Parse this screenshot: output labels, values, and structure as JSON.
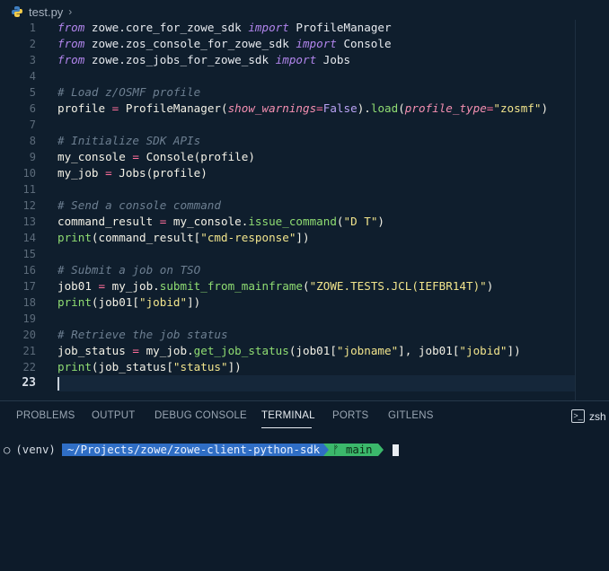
{
  "editor": {
    "breadcrumb": {
      "file_name": "test.py",
      "separator": "›"
    },
    "active_line": 23,
    "lines": [
      {
        "n": "1",
        "tokens": [
          [
            "kw",
            "from"
          ],
          [
            "mod",
            " zowe.core_for_zowe_sdk "
          ],
          [
            "kw",
            "import"
          ],
          [
            "mod",
            " ProfileManager"
          ]
        ]
      },
      {
        "n": "2",
        "tokens": [
          [
            "kw",
            "from"
          ],
          [
            "mod",
            " zowe.zos_console_for_zowe_sdk "
          ],
          [
            "kw",
            "import"
          ],
          [
            "mod",
            " Console"
          ]
        ]
      },
      {
        "n": "3",
        "tokens": [
          [
            "kw",
            "from"
          ],
          [
            "mod",
            " zowe.zos_jobs_for_zowe_sdk "
          ],
          [
            "kw",
            "import"
          ],
          [
            "mod",
            " Jobs"
          ]
        ]
      },
      {
        "n": "4",
        "tokens": []
      },
      {
        "n": "5",
        "tokens": [
          [
            "cm",
            "# Load z/OSMF profile"
          ]
        ]
      },
      {
        "n": "6",
        "tokens": [
          [
            "var",
            "profile "
          ],
          [
            "op",
            "="
          ],
          [
            "var",
            " ProfileManager("
          ],
          [
            "param",
            "show_warnings"
          ],
          [
            "op",
            "="
          ],
          [
            "bool",
            "False"
          ],
          [
            "var",
            ")."
          ],
          [
            "fn",
            "load"
          ],
          [
            "var",
            "("
          ],
          [
            "param",
            "profile_type"
          ],
          [
            "op",
            "="
          ],
          [
            "str",
            "\"zosmf\""
          ],
          [
            "var",
            ")"
          ]
        ]
      },
      {
        "n": "7",
        "tokens": []
      },
      {
        "n": "8",
        "tokens": [
          [
            "cm",
            "# Initialize SDK APIs"
          ]
        ]
      },
      {
        "n": "9",
        "tokens": [
          [
            "var",
            "my_console "
          ],
          [
            "op",
            "="
          ],
          [
            "var",
            " Console(profile)"
          ]
        ]
      },
      {
        "n": "10",
        "tokens": [
          [
            "var",
            "my_job "
          ],
          [
            "op",
            "="
          ],
          [
            "var",
            " Jobs(profile)"
          ]
        ]
      },
      {
        "n": "11",
        "tokens": []
      },
      {
        "n": "12",
        "tokens": [
          [
            "cm",
            "# Send a console command"
          ]
        ]
      },
      {
        "n": "13",
        "tokens": [
          [
            "var",
            "command_result "
          ],
          [
            "op",
            "="
          ],
          [
            "var",
            " my_console."
          ],
          [
            "fn",
            "issue_command"
          ],
          [
            "var",
            "("
          ],
          [
            "str",
            "\"D T\""
          ],
          [
            "var",
            ")"
          ]
        ]
      },
      {
        "n": "14",
        "tokens": [
          [
            "fn",
            "print"
          ],
          [
            "var",
            "(command_result["
          ],
          [
            "str",
            "\"cmd-response\""
          ],
          [
            "var",
            "])"
          ]
        ]
      },
      {
        "n": "15",
        "tokens": []
      },
      {
        "n": "16",
        "tokens": [
          [
            "cm",
            "# Submit a job on TSO"
          ]
        ]
      },
      {
        "n": "17",
        "tokens": [
          [
            "var",
            "job01 "
          ],
          [
            "op",
            "="
          ],
          [
            "var",
            " my_job."
          ],
          [
            "fn",
            "submit_from_mainframe"
          ],
          [
            "var",
            "("
          ],
          [
            "str",
            "\"ZOWE.TESTS.JCL(IEFBR14T)\""
          ],
          [
            "var",
            ")"
          ]
        ]
      },
      {
        "n": "18",
        "tokens": [
          [
            "fn",
            "print"
          ],
          [
            "var",
            "(job01["
          ],
          [
            "str",
            "\"jobid\""
          ],
          [
            "var",
            "])"
          ]
        ]
      },
      {
        "n": "19",
        "tokens": []
      },
      {
        "n": "20",
        "tokens": [
          [
            "cm",
            "# Retrieve the job status"
          ]
        ]
      },
      {
        "n": "21",
        "tokens": [
          [
            "var",
            "job_status "
          ],
          [
            "op",
            "="
          ],
          [
            "var",
            " my_job."
          ],
          [
            "fn",
            "get_job_status"
          ],
          [
            "var",
            "(job01["
          ],
          [
            "str",
            "\"jobname\""
          ],
          [
            "var",
            "], job01["
          ],
          [
            "str",
            "\"jobid\""
          ],
          [
            "var",
            "])"
          ]
        ]
      },
      {
        "n": "22",
        "tokens": [
          [
            "fn",
            "print"
          ],
          [
            "var",
            "(job_status["
          ],
          [
            "str",
            "\"status\""
          ],
          [
            "var",
            "])"
          ]
        ]
      },
      {
        "n": "23",
        "tokens": []
      }
    ]
  },
  "panel": {
    "tabs": [
      {
        "label": "PROBLEMS",
        "active": false
      },
      {
        "label": "OUTPUT",
        "active": false
      },
      {
        "label": "DEBUG CONSOLE",
        "active": false
      },
      {
        "label": "TERMINAL",
        "active": true
      },
      {
        "label": "PORTS",
        "active": false
      },
      {
        "label": "GITLENS",
        "active": false
      }
    ],
    "shell_name": "zsh",
    "shell_icon": ">_"
  },
  "terminal": {
    "status_glyph": "○",
    "venv": "(venv)",
    "path": "~/Projects/zowe/zowe-client-python-sdk",
    "git_branch": "ᚠ main"
  },
  "colors": {
    "editor_bg": "#0f1e2d",
    "keyword": "#b084eb",
    "string": "#f1e48c",
    "function": "#8fdc72",
    "comment": "#6d7f91",
    "path_segment": "#2f6ec5",
    "git_segment": "#3bb86b"
  }
}
